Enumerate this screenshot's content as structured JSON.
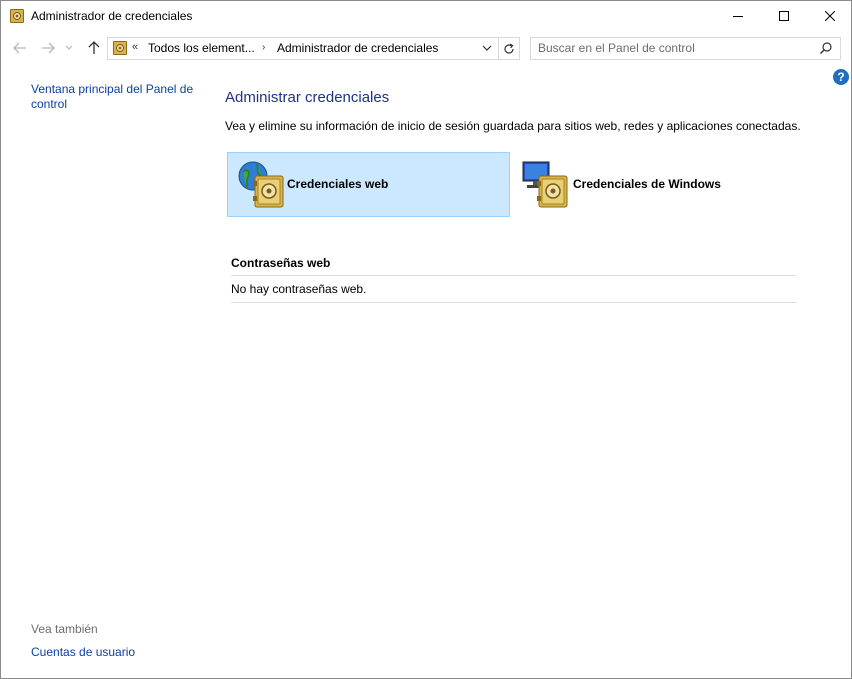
{
  "window": {
    "title": "Administrador de credenciales"
  },
  "navigation": {
    "breadcrumb_prefix": "«",
    "breadcrumb": [
      "Todos los element...",
      "Administrador de credenciales"
    ],
    "breadcrumb_separator": "›",
    "search_placeholder": "Buscar en el Panel de control"
  },
  "sidebar": {
    "home_link": "Ventana principal del Panel de control",
    "see_also_heading": "Vea también",
    "see_also_links": [
      "Cuentas de usuario"
    ]
  },
  "main": {
    "title": "Administrar credenciales",
    "description": "Vea y elimine su información de inicio de sesión guardada para sitios web, redes y aplicaciones conectadas.",
    "tiles": [
      {
        "label": "Credenciales web",
        "icon": "web-credentials-icon",
        "selected": true
      },
      {
        "label": "Credenciales de Windows",
        "icon": "windows-credentials-icon",
        "selected": false
      }
    ],
    "section": {
      "heading": "Contraseñas web",
      "empty_text": "No hay contraseñas web."
    }
  },
  "help": {
    "glyph": "?"
  },
  "colors": {
    "accent_link": "#0b40a5",
    "title_blue": "#1e3287",
    "tile_selected_bg": "#cce8ff",
    "tile_selected_border": "#99d1ff"
  }
}
